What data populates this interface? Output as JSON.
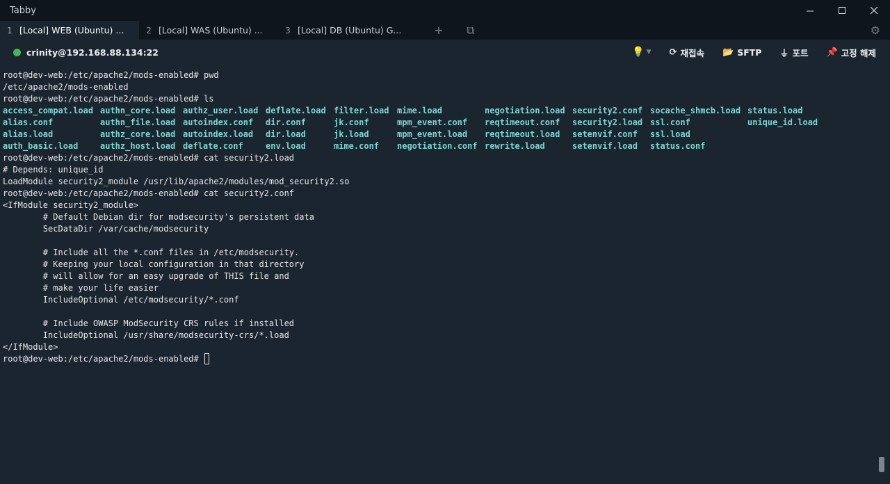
{
  "window": {
    "title": "Tabby",
    "controls": [
      "minimize-icon",
      "maximize-icon",
      "close-icon"
    ]
  },
  "tabs": [
    {
      "num": "1",
      "label": "[Local] WEB (Ubuntu) ...",
      "active": true
    },
    {
      "num": "2",
      "label": "[Local] WAS (Ubuntu) ...",
      "active": false
    },
    {
      "num": "3",
      "label": "[Local] DB (Ubuntu) G...",
      "active": false
    }
  ],
  "tab_actions": {
    "new_tab_icon": "+",
    "split_icon": "⧉"
  },
  "connection": {
    "host": "crinity@192.168.88.134:22",
    "status_color": "#3fb950",
    "reconnect": "재접속",
    "sftp": "SFTP",
    "ports": "포트",
    "unpin": "고정 해제"
  },
  "terminal": {
    "lines_before": [
      "root@dev-web:/etc/apache2/mods-enabled# pwd",
      "/etc/apache2/mods-enabled",
      "root@dev-web:/etc/apache2/mods-enabled# ls"
    ],
    "ls_color": "#7ad7d0",
    "ls_rows": [
      [
        "access_compat.load",
        "authn_core.load",
        "authz_user.load",
        "deflate.load",
        "filter.load",
        "mime.load",
        "negotiation.load",
        "security2.conf",
        "socache_shmcb.load",
        "status.load"
      ],
      [
        "alias.conf",
        "authn_file.load",
        "autoindex.conf",
        "dir.conf",
        "jk.conf",
        "mpm_event.conf",
        "reqtimeout.conf",
        "security2.load",
        "ssl.conf",
        "unique_id.load"
      ],
      [
        "alias.load",
        "authz_core.load",
        "autoindex.load",
        "dir.load",
        "jk.load",
        "mpm_event.load",
        "reqtimeout.load",
        "setenvif.conf",
        "ssl.load",
        ""
      ],
      [
        "auth_basic.load",
        "authz_host.load",
        "deflate.conf",
        "env.load",
        "mime.conf",
        "negotiation.conf",
        "rewrite.load",
        "setenvif.load",
        "status.conf",
        ""
      ]
    ],
    "lines_after": [
      "root@dev-web:/etc/apache2/mods-enabled# cat security2.load",
      "# Depends: unique_id",
      "LoadModule security2_module /usr/lib/apache2/modules/mod_security2.so",
      "root@dev-web:/etc/apache2/mods-enabled# cat security2.conf",
      "<IfModule security2_module>",
      "        # Default Debian dir for modsecurity's persistent data",
      "        SecDataDir /var/cache/modsecurity",
      "",
      "        # Include all the *.conf files in /etc/modsecurity.",
      "        # Keeping your local configuration in that directory",
      "        # will allow for an easy upgrade of THIS file and",
      "        # make your life easier",
      "        IncludeOptional /etc/modsecurity/*.conf",
      "",
      "        # Include OWASP ModSecurity CRS rules if installed",
      "        IncludeOptional /usr/share/modsecurity-crs/*.load",
      "</IfModule>"
    ],
    "prompt": "root@dev-web:/etc/apache2/mods-enabled# "
  }
}
